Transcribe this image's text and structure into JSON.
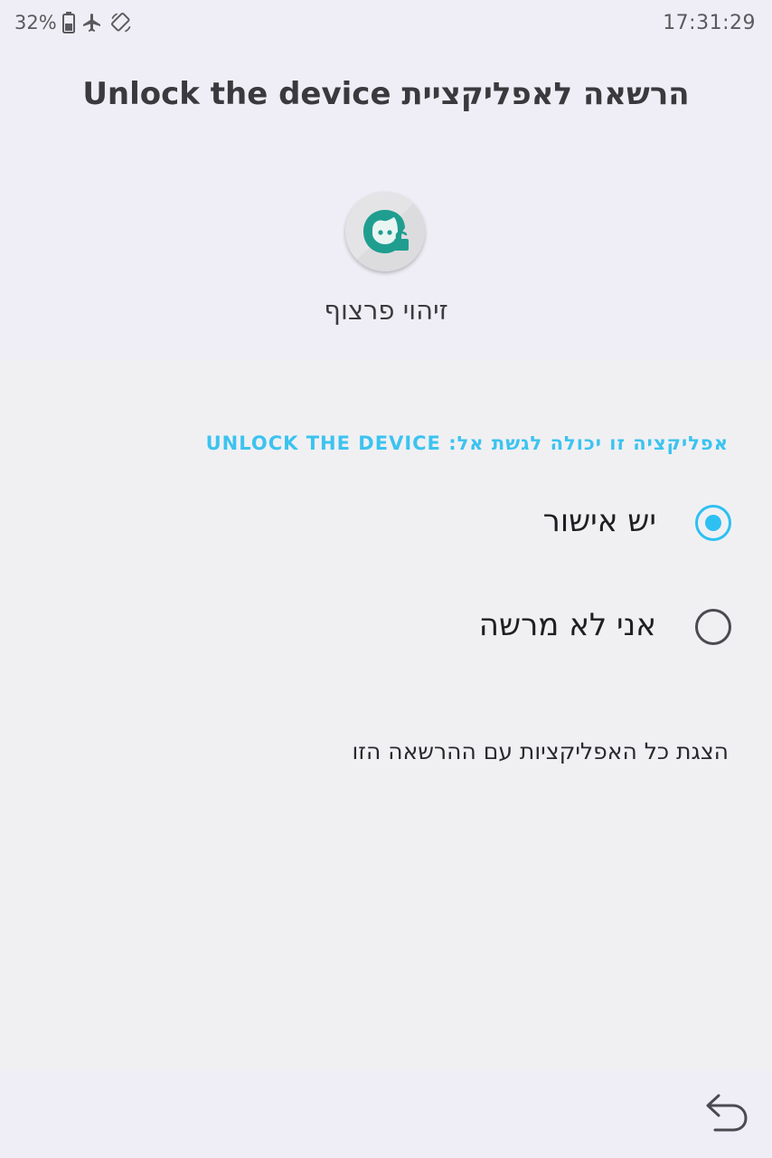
{
  "status_bar": {
    "battery_percent": "32%",
    "time": "17:31:29",
    "icons": [
      "battery-icon",
      "airplane-icon",
      "screen-rotation-icon"
    ]
  },
  "header": {
    "title": "הרשאה לאפליקציית Unlock the device",
    "app_name": "זיהוי פרצוף",
    "app_icon": "face-unlock-icon"
  },
  "permission": {
    "section_label": "אפליקציה זו יכולה לגשת אל: UNLOCK THE DEVICE",
    "options": [
      {
        "label": "יש אישור",
        "selected": true
      },
      {
        "label": "אני לא מרשה",
        "selected": false
      }
    ],
    "show_all_link": "הצגת כל האפליקציות עם ההרשאה הזו"
  },
  "bottom_bar": {
    "back_icon": "back-arrow-icon"
  },
  "colors": {
    "accent": "#2ec0f2",
    "section_label": "#3cc3ef",
    "icon_teal": "#1f9e8f",
    "header_bg": "#efeef6",
    "content_bg": "#f0f0f3"
  }
}
